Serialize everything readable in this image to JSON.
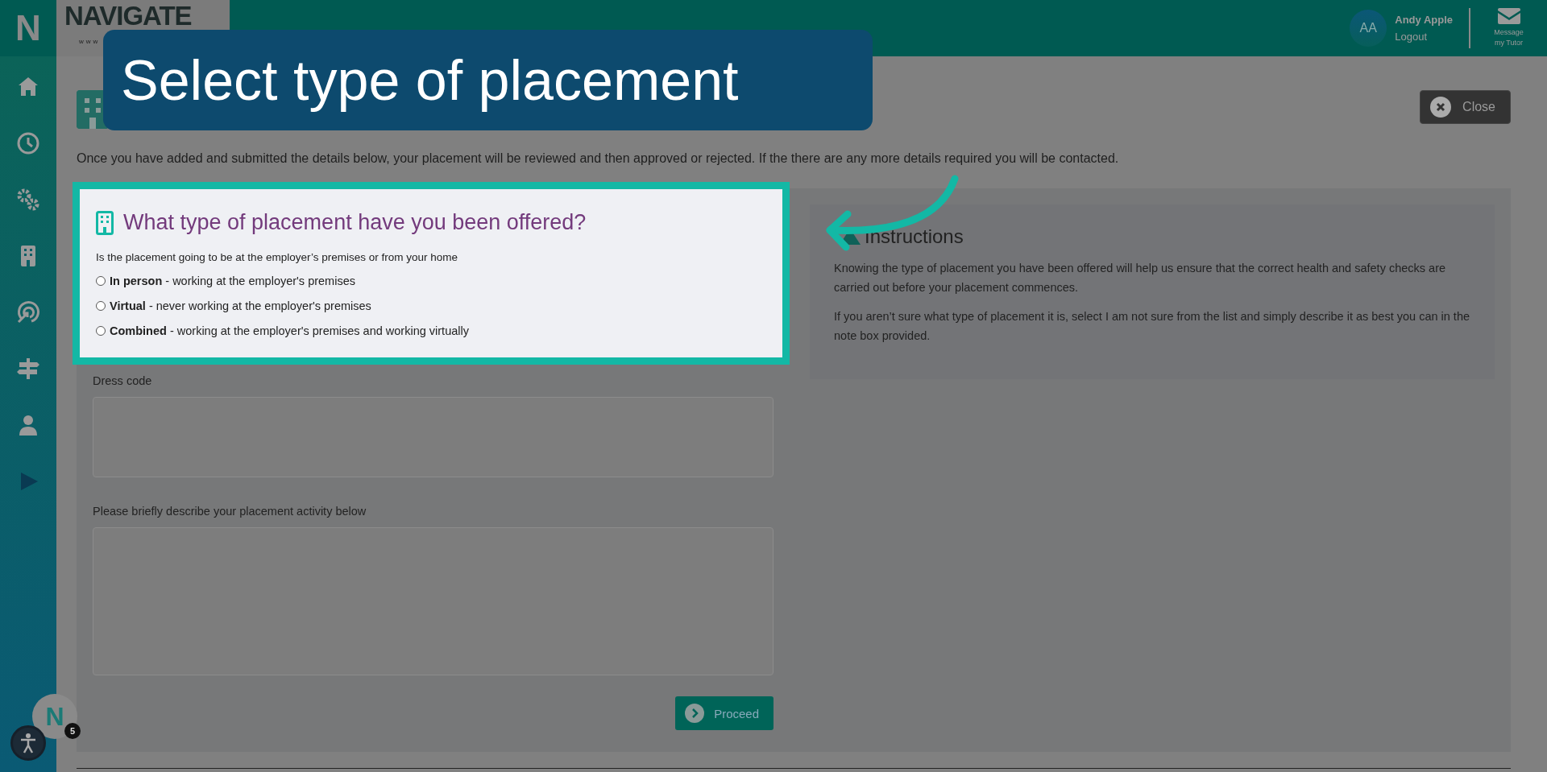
{
  "header": {
    "logo_letter": "N",
    "logo_text": "NAVIGATE",
    "logo_subtext": "www",
    "user": {
      "initials": "AA",
      "name": "Andy Apple",
      "logout": "Logout"
    },
    "message_label": "Message my Tutor"
  },
  "page": {
    "close_label": "Close",
    "intro": "Once you have added and submitted the details below, your placement will be reviewed and then approved or rejected. If the there are any more details required you will be contacted."
  },
  "question": {
    "title": "What type of placement have you been offered?",
    "prompt": "Is the placement going to be at the employer’s premises or from your home",
    "options": [
      {
        "text": "**In person** - working at the employer's premises",
        "selected": false
      },
      {
        "text": "**Virtual** - never working at the employer's premises",
        "selected": false
      },
      {
        "text": "**Combined** - working at the employer's premises and working virtually",
        "selected": false
      }
    ]
  },
  "fields": [
    {
      "label": "Dress code"
    },
    {
      "label": "Please briefly describe your placement activity below"
    }
  ],
  "proceed_label": "Proceed",
  "instructions": {
    "title": "Instructions",
    "paragraphs": [
      "Knowing the type of placement you have been offered will help us ensure that the correct health and safety checks are carried out before your placement commences.",
      "If you aren’t sure what type of placement it is, select I am not sure from the list and simply describe it as best you can in the note box provided."
    ]
  },
  "tour": {
    "callout": "Select type of placement",
    "launcher_letter": "N",
    "badge": "5"
  }
}
